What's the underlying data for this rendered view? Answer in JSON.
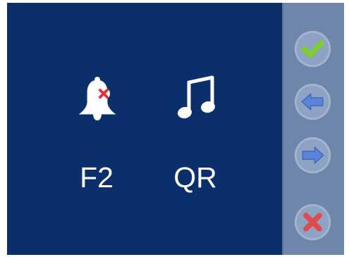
{
  "main": {
    "items": [
      {
        "icon": "bell-mute-icon",
        "label": "F2"
      },
      {
        "icon": "music-note-icon",
        "label": "QR"
      }
    ]
  },
  "sidebar": {
    "buttons": [
      {
        "icon": "checkmark-icon",
        "action": "confirm"
      },
      {
        "icon": "arrow-left-icon",
        "action": "previous"
      },
      {
        "icon": "arrow-right-icon",
        "action": "next"
      },
      {
        "icon": "close-icon",
        "action": "cancel"
      }
    ]
  },
  "colors": {
    "main_background": "#0a2f6b",
    "side_background": "#6f86ab",
    "text": "#ffffff",
    "check_green": "#7ecf2b",
    "arrow_blue": "#5b84d8",
    "cancel_red": "#e14b4b"
  }
}
